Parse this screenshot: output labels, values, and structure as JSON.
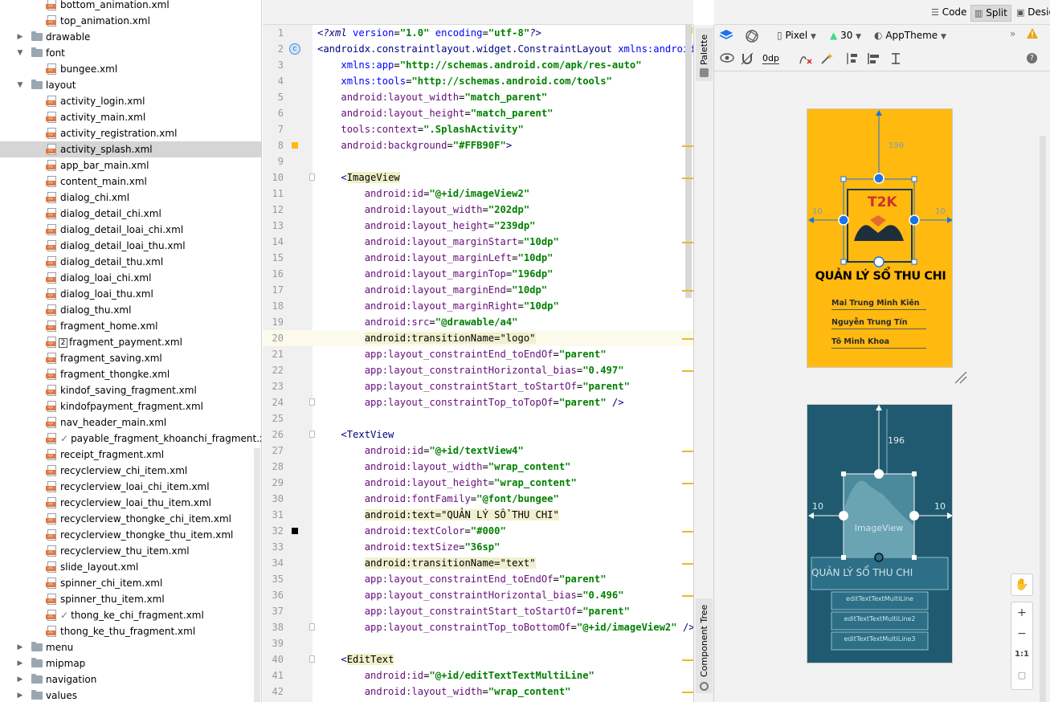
{
  "tree": {
    "items": [
      {
        "type": "file",
        "label": "bottom_animation.xml",
        "depth": 2
      },
      {
        "type": "file",
        "label": "top_animation.xml",
        "depth": 2
      },
      {
        "type": "folder",
        "label": "drawable",
        "depth": 1,
        "expanded": false
      },
      {
        "type": "folder",
        "label": "font",
        "depth": 1,
        "expanded": true
      },
      {
        "type": "file",
        "label": "bungee.xml",
        "depth": 2
      },
      {
        "type": "folder",
        "label": "layout",
        "depth": 1,
        "expanded": true
      },
      {
        "type": "file",
        "label": "activity_login.xml",
        "depth": 2
      },
      {
        "type": "file",
        "label": "activity_main.xml",
        "depth": 2
      },
      {
        "type": "file",
        "label": "activity_registration.xml",
        "depth": 2
      },
      {
        "type": "file",
        "label": "activity_splash.xml",
        "depth": 2,
        "selected": true
      },
      {
        "type": "file",
        "label": "app_bar_main.xml",
        "depth": 2
      },
      {
        "type": "file",
        "label": "content_main.xml",
        "depth": 2
      },
      {
        "type": "file",
        "label": "dialog_chi.xml",
        "depth": 2
      },
      {
        "type": "file",
        "label": "dialog_detail_chi.xml",
        "depth": 2
      },
      {
        "type": "file",
        "label": "dialog_detail_loai_chi.xml",
        "depth": 2
      },
      {
        "type": "file",
        "label": "dialog_detail_loai_thu.xml",
        "depth": 2
      },
      {
        "type": "file",
        "label": "dialog_detail_thu.xml",
        "depth": 2
      },
      {
        "type": "file",
        "label": "dialog_loai_chi.xml",
        "depth": 2
      },
      {
        "type": "file",
        "label": "dialog_loai_thu.xml",
        "depth": 2
      },
      {
        "type": "file",
        "label": "dialog_thu.xml",
        "depth": 2
      },
      {
        "type": "file",
        "label": "fragment_home.xml",
        "depth": 2
      },
      {
        "type": "file",
        "label": "fragment_payment.xml",
        "depth": 2,
        "badge": "2"
      },
      {
        "type": "file",
        "label": "fragment_saving.xml",
        "depth": 2
      },
      {
        "type": "file",
        "label": "fragment_thongke.xml",
        "depth": 2
      },
      {
        "type": "file",
        "label": "kindof_saving_fragment.xml",
        "depth": 2
      },
      {
        "type": "file",
        "label": "kindofpayment_fragment.xml",
        "depth": 2
      },
      {
        "type": "file",
        "label": "nav_header_main.xml",
        "depth": 2
      },
      {
        "type": "file",
        "label": "payable_fragment_khoanchi_fragment.xml",
        "depth": 2,
        "check": "✓"
      },
      {
        "type": "file",
        "label": "receipt_fragment.xml",
        "depth": 2
      },
      {
        "type": "file",
        "label": "recyclerview_chi_item.xml",
        "depth": 2
      },
      {
        "type": "file",
        "label": "recyclerview_loai_chi_item.xml",
        "depth": 2
      },
      {
        "type": "file",
        "label": "recyclerview_loai_thu_item.xml",
        "depth": 2
      },
      {
        "type": "file",
        "label": "recyclerview_thongke_chi_item.xml",
        "depth": 2
      },
      {
        "type": "file",
        "label": "recyclerview_thongke_thu_item.xml",
        "depth": 2
      },
      {
        "type": "file",
        "label": "recyclerview_thu_item.xml",
        "depth": 2
      },
      {
        "type": "file",
        "label": "slide_layout.xml",
        "depth": 2
      },
      {
        "type": "file",
        "label": "spinner_chi_item.xml",
        "depth": 2
      },
      {
        "type": "file",
        "label": "spinner_thu_item.xml",
        "depth": 2
      },
      {
        "type": "file",
        "label": "thong_ke_chi_fragment.xml",
        "depth": 2,
        "check": "✓"
      },
      {
        "type": "file",
        "label": "thong_ke_thu_fragment.xml",
        "depth": 2
      },
      {
        "type": "folder",
        "label": "menu",
        "depth": 1,
        "expanded": false
      },
      {
        "type": "folder",
        "label": "mipmap",
        "depth": 1,
        "expanded": false
      },
      {
        "type": "folder",
        "label": "navigation",
        "depth": 1,
        "expanded": false
      },
      {
        "type": "folder",
        "label": "values",
        "depth": 1,
        "expanded": false
      }
    ]
  },
  "editor": {
    "current_line": 20,
    "lines": [
      {
        "n": "1",
        "segs": [
          [
            "pi",
            "<?xml "
          ],
          [
            "attrb",
            "version"
          ],
          [
            "pun",
            "="
          ],
          [
            "str",
            "\"1.0\""
          ],
          [
            "pun",
            " "
          ],
          [
            "attrb",
            "encoding"
          ],
          [
            "pun",
            "="
          ],
          [
            "str",
            "\"utf-8\""
          ],
          [
            "pi",
            "?>"
          ]
        ]
      },
      {
        "n": "2",
        "gutter": "c",
        "segs": [
          [
            "tag",
            "<androidx.constraintlayout.widget.ConstraintLayout "
          ],
          [
            "attrb",
            "xmlns:android"
          ],
          [
            "pun",
            "="
          ],
          [
            "str",
            "\"h"
          ]
        ]
      },
      {
        "n": "3",
        "segs": [
          [
            "pun",
            "    "
          ],
          [
            "attrb",
            "xmlns:app"
          ],
          [
            "pun",
            "="
          ],
          [
            "str",
            "\"http://schemas.android.com/apk/res-auto\""
          ]
        ]
      },
      {
        "n": "4",
        "segs": [
          [
            "pun",
            "    "
          ],
          [
            "attrb",
            "xmlns:tools"
          ],
          [
            "pun",
            "="
          ],
          [
            "str",
            "\"http://schemas.android.com/tools\""
          ]
        ]
      },
      {
        "n": "5",
        "segs": [
          [
            "pun",
            "    "
          ],
          [
            "attr",
            "android:layout_width"
          ],
          [
            "pun",
            "="
          ],
          [
            "str",
            "\"match_parent\""
          ]
        ]
      },
      {
        "n": "6",
        "segs": [
          [
            "pun",
            "    "
          ],
          [
            "attr",
            "android:layout_height"
          ],
          [
            "pun",
            "="
          ],
          [
            "str",
            "\"match_parent\""
          ]
        ]
      },
      {
        "n": "7",
        "segs": [
          [
            "pun",
            "    "
          ],
          [
            "attr",
            "tools:context"
          ],
          [
            "pun",
            "="
          ],
          [
            "str",
            "\".SplashActivity\""
          ]
        ]
      },
      {
        "n": "8",
        "gutter": "swatch",
        "segs": [
          [
            "pun",
            "    "
          ],
          [
            "attr",
            "android:background"
          ],
          [
            "pun",
            "="
          ],
          [
            "str",
            "\"#FFB90F\""
          ],
          [
            "tag",
            ">"
          ]
        ]
      },
      {
        "n": "9",
        "segs": []
      },
      {
        "n": "10",
        "fold": true,
        "segs": [
          [
            "pun",
            "    "
          ],
          [
            "tag",
            "<"
          ],
          [
            "tagbox",
            "ImageView"
          ]
        ]
      },
      {
        "n": "11",
        "segs": [
          [
            "pun",
            "        "
          ],
          [
            "attr",
            "android:id"
          ],
          [
            "pun",
            "="
          ],
          [
            "str",
            "\"@+id/imageView2\""
          ]
        ]
      },
      {
        "n": "12",
        "segs": [
          [
            "pun",
            "        "
          ],
          [
            "attr",
            "android:layout_width"
          ],
          [
            "pun",
            "="
          ],
          [
            "str",
            "\"202dp\""
          ]
        ]
      },
      {
        "n": "13",
        "segs": [
          [
            "pun",
            "        "
          ],
          [
            "attr",
            "android:layout_height"
          ],
          [
            "pun",
            "="
          ],
          [
            "str",
            "\"239dp\""
          ]
        ]
      },
      {
        "n": "14",
        "segs": [
          [
            "pun",
            "        "
          ],
          [
            "attr",
            "android:layout_marginStart"
          ],
          [
            "pun",
            "="
          ],
          [
            "str",
            "\"10dp\""
          ]
        ]
      },
      {
        "n": "15",
        "segs": [
          [
            "pun",
            "        "
          ],
          [
            "attr",
            "android:layout_marginLeft"
          ],
          [
            "pun",
            "="
          ],
          [
            "str",
            "\"10dp\""
          ]
        ]
      },
      {
        "n": "16",
        "segs": [
          [
            "pun",
            "        "
          ],
          [
            "attr",
            "android:layout_marginTop"
          ],
          [
            "pun",
            "="
          ],
          [
            "str",
            "\"196dp\""
          ]
        ]
      },
      {
        "n": "17",
        "segs": [
          [
            "pun",
            "        "
          ],
          [
            "attr",
            "android:layout_marginEnd"
          ],
          [
            "pun",
            "="
          ],
          [
            "str",
            "\"10dp\""
          ]
        ]
      },
      {
        "n": "18",
        "segs": [
          [
            "pun",
            "        "
          ],
          [
            "attr",
            "android:layout_marginRight"
          ],
          [
            "pun",
            "="
          ],
          [
            "str",
            "\"10dp\""
          ]
        ]
      },
      {
        "n": "19",
        "segs": [
          [
            "pun",
            "        "
          ],
          [
            "attr",
            "android:src"
          ],
          [
            "pun",
            "="
          ],
          [
            "str",
            "\"@drawable/a4\""
          ]
        ]
      },
      {
        "n": "20",
        "segs": [
          [
            "pun",
            "        "
          ],
          [
            "hl",
            "android:transitionName=\"logo\""
          ]
        ]
      },
      {
        "n": "21",
        "segs": [
          [
            "pun",
            "        "
          ],
          [
            "attr",
            "app:layout_constraintEnd_toEndOf"
          ],
          [
            "pun",
            "="
          ],
          [
            "str",
            "\"parent\""
          ]
        ]
      },
      {
        "n": "22",
        "segs": [
          [
            "pun",
            "        "
          ],
          [
            "attr",
            "app:layout_constraintHorizontal_bias"
          ],
          [
            "pun",
            "="
          ],
          [
            "str",
            "\"0.497\""
          ]
        ]
      },
      {
        "n": "23",
        "segs": [
          [
            "pun",
            "        "
          ],
          [
            "attr",
            "app:layout_constraintStart_toStartOf"
          ],
          [
            "pun",
            "="
          ],
          [
            "str",
            "\"parent\""
          ]
        ]
      },
      {
        "n": "24",
        "fold": true,
        "segs": [
          [
            "pun",
            "        "
          ],
          [
            "attr",
            "app:layout_constraintTop_toTopOf"
          ],
          [
            "pun",
            "="
          ],
          [
            "str",
            "\"parent\""
          ],
          [
            "tag",
            " />"
          ]
        ]
      },
      {
        "n": "25",
        "segs": []
      },
      {
        "n": "26",
        "fold": true,
        "segs": [
          [
            "pun",
            "    "
          ],
          [
            "tag",
            "<TextView"
          ]
        ]
      },
      {
        "n": "27",
        "segs": [
          [
            "pun",
            "        "
          ],
          [
            "attr",
            "android:id"
          ],
          [
            "pun",
            "="
          ],
          [
            "str",
            "\"@+id/textView4\""
          ]
        ]
      },
      {
        "n": "28",
        "segs": [
          [
            "pun",
            "        "
          ],
          [
            "attr",
            "android:layout_width"
          ],
          [
            "pun",
            "="
          ],
          [
            "str",
            "\"wrap_content\""
          ]
        ]
      },
      {
        "n": "29",
        "segs": [
          [
            "pun",
            "        "
          ],
          [
            "attr",
            "android:layout_height"
          ],
          [
            "pun",
            "="
          ],
          [
            "str",
            "\"wrap_content\""
          ]
        ]
      },
      {
        "n": "30",
        "segs": [
          [
            "pun",
            "        "
          ],
          [
            "attr",
            "android:fontFamily"
          ],
          [
            "pun",
            "="
          ],
          [
            "str",
            "\"@font/bungee\""
          ]
        ]
      },
      {
        "n": "31",
        "segs": [
          [
            "pun",
            "        "
          ],
          [
            "hl",
            "android:text=\"QUẢN LÝ SỔ THU CHI\""
          ]
        ]
      },
      {
        "n": "32",
        "gutter": "black",
        "segs": [
          [
            "pun",
            "        "
          ],
          [
            "attr",
            "android:textColor"
          ],
          [
            "pun",
            "="
          ],
          [
            "str",
            "\"#000\""
          ]
        ]
      },
      {
        "n": "33",
        "segs": [
          [
            "pun",
            "        "
          ],
          [
            "attr",
            "android:textSize"
          ],
          [
            "pun",
            "="
          ],
          [
            "str",
            "\"36sp\""
          ]
        ]
      },
      {
        "n": "34",
        "segs": [
          [
            "pun",
            "        "
          ],
          [
            "hl",
            "android:transitionName=\"text\""
          ]
        ]
      },
      {
        "n": "35",
        "segs": [
          [
            "pun",
            "        "
          ],
          [
            "attr",
            "app:layout_constraintEnd_toEndOf"
          ],
          [
            "pun",
            "="
          ],
          [
            "str",
            "\"parent\""
          ]
        ]
      },
      {
        "n": "36",
        "segs": [
          [
            "pun",
            "        "
          ],
          [
            "attr",
            "app:layout_constraintHorizontal_bias"
          ],
          [
            "pun",
            "="
          ],
          [
            "str",
            "\"0.496\""
          ]
        ]
      },
      {
        "n": "37",
        "segs": [
          [
            "pun",
            "        "
          ],
          [
            "attr",
            "app:layout_constraintStart_toStartOf"
          ],
          [
            "pun",
            "="
          ],
          [
            "str",
            "\"parent\""
          ]
        ]
      },
      {
        "n": "38",
        "fold": true,
        "segs": [
          [
            "pun",
            "        "
          ],
          [
            "attr",
            "app:layout_constraintTop_toBottomOf"
          ],
          [
            "pun",
            "="
          ],
          [
            "str",
            "\"@+id/imageView2\""
          ],
          [
            "tag",
            " />"
          ]
        ]
      },
      {
        "n": "39",
        "segs": []
      },
      {
        "n": "40",
        "fold": true,
        "segs": [
          [
            "pun",
            "    "
          ],
          [
            "tag",
            "<"
          ],
          [
            "tagbox",
            "EditText"
          ]
        ]
      },
      {
        "n": "41",
        "segs": [
          [
            "pun",
            "        "
          ],
          [
            "attr",
            "android:id"
          ],
          [
            "pun",
            "="
          ],
          [
            "str",
            "\"@+id/editTextTextMultiLine\""
          ]
        ]
      },
      {
        "n": "42",
        "segs": [
          [
            "pun",
            "        "
          ],
          [
            "attr",
            "android:layout_width"
          ],
          [
            "pun",
            "="
          ],
          [
            "str",
            "\"wrap_content\""
          ]
        ]
      }
    ]
  },
  "editor_marks_rows": [
    8,
    10,
    14,
    17,
    20,
    22,
    27,
    29,
    32,
    34,
    36,
    40,
    42
  ],
  "side_strip": {
    "palette": "Palette",
    "component_tree": "Component Tree"
  },
  "view_modes": {
    "code": "Code",
    "split": "Split",
    "design": "Desig",
    "active": "split"
  },
  "design_toolbar": {
    "device": "Pixel",
    "api": "30",
    "theme": "AppTheme",
    "margin": "0dp"
  },
  "design_preview": {
    "background_color": "#FFB90F",
    "logo_text": "T2K",
    "title": "QUẢN LÝ SỔ THU CHI",
    "members": [
      "Mai Trung Minh Kiên",
      "Nguyễn Trung Tín",
      "Tô Minh Khoa"
    ],
    "dim_top": "196",
    "dim_left": "10",
    "dim_right": "10"
  },
  "blueprint_preview": {
    "background_color": "#1f5a70",
    "dim_top": "196",
    "dim_left": "10",
    "dim_right": "10",
    "image_label": "ImageView",
    "text_label": "QUẢN LÝ SỔ THU CHI",
    "edit_labels": [
      "editTextTextMultiLine",
      "editTextTextMultiLine2",
      "editTextTextMultiLine3"
    ]
  },
  "zoom": {
    "plus": "+",
    "minus": "−",
    "ratio": "1:1"
  },
  "colors": {
    "accent_blue": "#1a73e8",
    "warning": "#e8a317",
    "selection": "#d5d5d5"
  }
}
